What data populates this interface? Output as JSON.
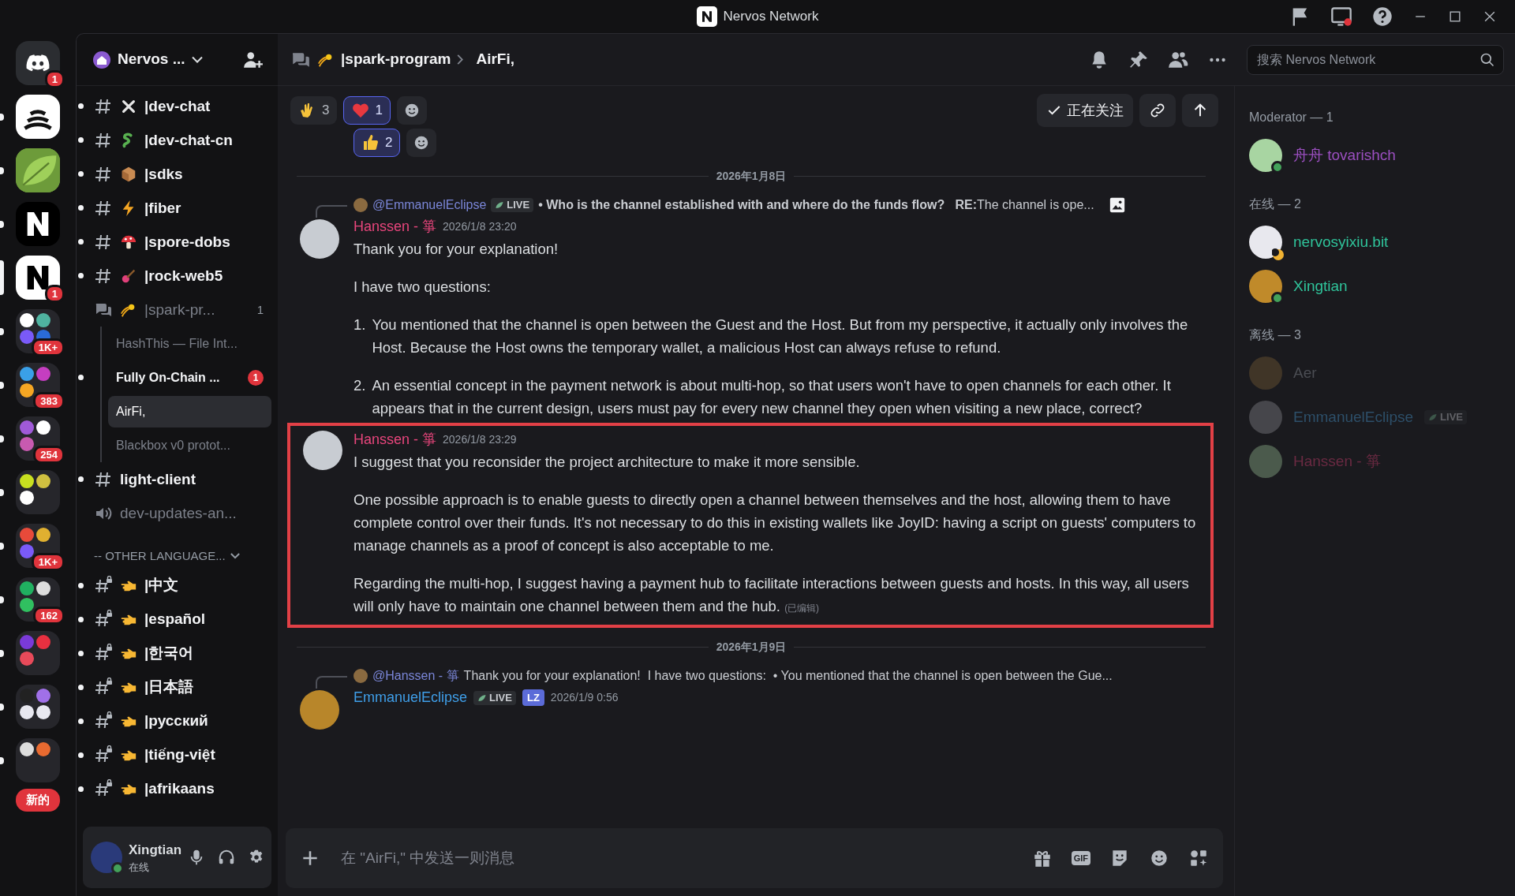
{
  "title_bar": {
    "title": "Nervos Network"
  },
  "servers": [
    {
      "kind": "home",
      "selected": false,
      "unread": false,
      "badge": "1"
    },
    {
      "kind": "server",
      "selected": false,
      "unread": true
    },
    {
      "kind": "server",
      "selected": false,
      "unread": true
    },
    {
      "kind": "server",
      "selected": false,
      "unread": true
    },
    {
      "kind": "server",
      "selected": true,
      "badge": "1"
    },
    {
      "kind": "folder",
      "selected": false,
      "unread": true,
      "badge": "1K+"
    },
    {
      "kind": "folder",
      "selected": false,
      "unread": true,
      "badge": "383"
    },
    {
      "kind": "folder",
      "selected": false,
      "unread": true,
      "badge": "254"
    },
    {
      "kind": "folder",
      "selected": false,
      "unread": true
    },
    {
      "kind": "folder",
      "selected": false,
      "unread": true,
      "badge": "1K+"
    },
    {
      "kind": "folder",
      "selected": false,
      "unread": true,
      "badge": "162"
    },
    {
      "kind": "folder",
      "selected": false,
      "unread": true
    },
    {
      "kind": "folder",
      "selected": false,
      "unread": true
    },
    {
      "kind": "folder",
      "selected": false,
      "unread": true
    }
  ],
  "new_badge": "新的",
  "server_header": {
    "name": "Nervos ..."
  },
  "channels": [
    {
      "kind": "text",
      "name": "|dev-chat",
      "unread": true,
      "selected": false
    },
    {
      "kind": "text",
      "name": "|dev-chat-cn",
      "unread": true,
      "selected": false
    },
    {
      "kind": "text",
      "name": "|sdks",
      "unread": true,
      "selected": false
    },
    {
      "kind": "text",
      "name": "|fiber",
      "unread": true,
      "selected": false
    },
    {
      "kind": "text",
      "name": "|spore-dobs",
      "unread": true,
      "selected": false
    },
    {
      "kind": "text",
      "name": "|rock-web5",
      "unread": true,
      "selected": false
    },
    {
      "kind": "forum",
      "name": "|spark-pr...",
      "count": "1",
      "unread": false,
      "selected": false,
      "children": [
        {
          "kind": "thread",
          "name": "HashThis — File Int...",
          "unread": false,
          "selected": false
        },
        {
          "kind": "thread",
          "name": "Fully On-Chain ...",
          "badge": "1",
          "unread": true,
          "selected": false
        },
        {
          "kind": "thread",
          "name": "AirFi,",
          "unread": false,
          "selected": true
        },
        {
          "kind": "thread",
          "name": "Blackbox v0 protot...",
          "unread": false,
          "selected": false
        }
      ]
    },
    {
      "kind": "text",
      "name": "light-client",
      "unread": true,
      "selected": false
    },
    {
      "kind": "voice",
      "name": "dev-updates-an...",
      "unread": false,
      "selected": false
    },
    {
      "kind": "category",
      "name": "-- OTHER LANGUAGE...",
      "children": [
        {
          "kind": "locked",
          "name": "|中文",
          "unread": true,
          "selected": false
        },
        {
          "kind": "locked",
          "name": "|español",
          "unread": true,
          "selected": false
        },
        {
          "kind": "locked",
          "name": "|한국어",
          "unread": true,
          "selected": false
        },
        {
          "kind": "locked",
          "name": "|日本語",
          "unread": true,
          "selected": false
        },
        {
          "kind": "locked",
          "name": "|русский",
          "unread": true,
          "selected": false
        },
        {
          "kind": "locked",
          "name": "|tiếng-việt",
          "unread": true,
          "selected": false
        },
        {
          "kind": "locked",
          "name": "|afrikaans",
          "unread": true,
          "selected": false
        }
      ]
    }
  ],
  "user_panel": {
    "name": "Xingtian",
    "status": "在线"
  },
  "channel_header": {
    "parent": "|spark-program",
    "thread": "AirFi,"
  },
  "search": {
    "placeholder": "搜索 Nervos Network"
  },
  "post_bar": {
    "reactions": [
      {
        "count": "3",
        "selected": false
      },
      {
        "count": "1",
        "selected": true
      }
    ],
    "follow_label": "正在关注"
  },
  "messages": [
    {
      "kind": "reactions",
      "reactions": [
        {
          "count": "2",
          "selected": true
        }
      ]
    },
    {
      "kind": "date",
      "text": "2026年1月8日"
    },
    {
      "kind": "message",
      "author": "Hanssen - 箏",
      "color": "#e8457c",
      "time": "2026/1/8 23:20",
      "reply": {
        "mention": "@EmmanuelEclipse",
        "tag": "LIVE",
        "text": "**• Who is the channel established with and where do the funds flow?**   **RE:**The channel is ope...",
        "attachment": true
      },
      "body": [
        {
          "kind": "paragraph",
          "text": "Thank you for your explanation!"
        },
        {
          "kind": "paragraph",
          "text": "I have two questions:"
        },
        {
          "kind": "list_item",
          "number": "1.",
          "text": "You mentioned that the channel is open between the Guest and the Host. But from my perspective, it actually only involves the Host. Because the Host owns the temporary wallet, a malicious Host can always refuse to refund."
        },
        {
          "kind": "list_item",
          "number": "2.",
          "text": "An essential concept in the payment network is about multi-hop, so that users won't have to open channels for each other. It appears that in the current design, users must pay for every new channel they open when visiting a new place, correct?"
        }
      ]
    },
    {
      "kind": "message",
      "highlighted": true,
      "author": "Hanssen - 箏",
      "color": "#e8457c",
      "time": "2026/1/8 23:29",
      "edited": "(已编辑)",
      "body": [
        {
          "kind": "paragraph",
          "text": "I suggest that you reconsider the project architecture to make it more sensible."
        },
        {
          "kind": "paragraph",
          "text": "One possible approach is to enable guests to directly open a channel between themselves and the host, allowing them to have complete control over their funds. It's not necessary to do this in existing wallets like JoyID: having a script on guests' computers to manage channels as a proof of concept is also acceptable to me."
        },
        {
          "kind": "paragraph",
          "text": "Regarding the multi-hop, I suggest having a payment hub to facilitate interactions between guests and hosts. In this way, all users will only have to maintain one channel between them and the hub."
        }
      ]
    },
    {
      "kind": "date",
      "text": "2026年1月9日"
    },
    {
      "kind": "message",
      "author": "EmmanuelEclipse",
      "color": "#3f9ee8",
      "time": "2026/1/9 0:56",
      "tags": [
        "LIVE",
        "LZ"
      ],
      "reply": {
        "mention": "@Hanssen - 箏",
        "text": "Thank you for your explanation!  I have two questions:  • You mentioned that the channel is open between the Gue..."
      }
    }
  ],
  "composer": {
    "placeholder": "在 \"AirFi,\" 中发送一则消息",
    "gif_label": "GIF"
  },
  "members": [
    {
      "title": "Moderator — 1",
      "members": [
        {
          "name": "舟舟 tovarishch",
          "color": "#9b4fc0",
          "offline": false,
          "idle": false
        }
      ]
    },
    {
      "title": "在线 — 2",
      "members": [
        {
          "name": "nervosyixiu.bit",
          "color": "#2fc39a",
          "offline": false,
          "idle": true
        },
        {
          "name": "Xingtian",
          "color": "#2fc39a",
          "offline": false,
          "idle": false
        }
      ]
    },
    {
      "title": "离线 — 3",
      "members": [
        {
          "name": "Aer",
          "color": "#4b4d53",
          "offline": true,
          "idle": false
        },
        {
          "name": "EmmanuelEclipse",
          "color": "#2d4f69",
          "offline": true,
          "idle": false,
          "tag": "LIVE"
        },
        {
          "name": "Hanssen - 箏",
          "color": "#6a2a42",
          "offline": true,
          "idle": false
        }
      ]
    }
  ]
}
